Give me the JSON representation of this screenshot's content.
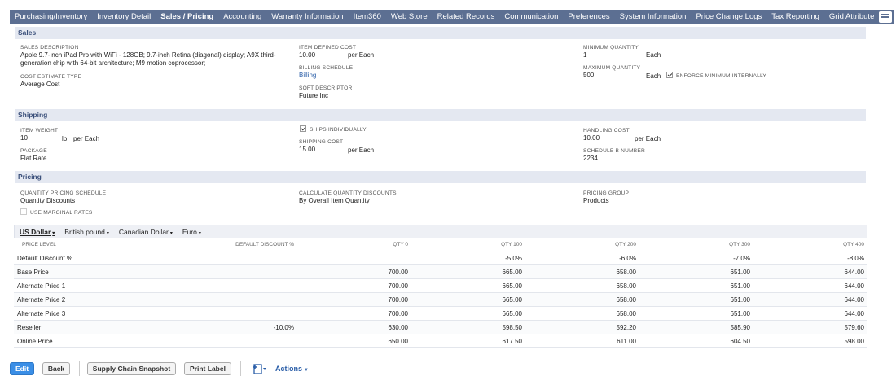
{
  "tabs": [
    "Purchasing/Inventory",
    "Inventory Detail",
    "Sales / Pricing",
    "Accounting",
    "Warranty Information",
    "Item360",
    "Web Store",
    "Related Records",
    "Communication",
    "Preferences",
    "System Information",
    "Price Change Logs",
    "Tax Reporting",
    "Grid Attribute"
  ],
  "active_tab": "Sales / Pricing",
  "sales": {
    "title": "Sales",
    "sales_description_label": "SALES DESCRIPTION",
    "sales_description_line1": "Apple 9.7-inch iPad Pro with WiFi - 128GB; 9.7-inch Retina (diagonal) display; A9X third-",
    "sales_description_line2": "generation chip with 64-bit architecture; M9 motion coprocessor;",
    "cost_estimate_type_label": "COST ESTIMATE TYPE",
    "cost_estimate_type": "Average Cost",
    "item_defined_cost_label": "ITEM DEFINED COST",
    "item_defined_cost": "10.00",
    "item_defined_cost_unit": "per Each",
    "billing_schedule_label": "BILLING SCHEDULE",
    "billing_schedule": "Billing",
    "soft_descriptor_label": "SOFT DESCRIPTOR",
    "soft_descriptor": "Future Inc",
    "minimum_quantity_label": "MINIMUM QUANTITY",
    "minimum_quantity": "1",
    "minimum_quantity_unit": "Each",
    "maximum_quantity_label": "MAXIMUM QUANTITY",
    "maximum_quantity": "500",
    "maximum_quantity_unit": "Each",
    "enforce_min_label": "ENFORCE MINIMUM INTERNALLY",
    "enforce_min_checked": true
  },
  "shipping": {
    "title": "Shipping",
    "item_weight_label": "ITEM WEIGHT",
    "item_weight": "10",
    "item_weight_unit1": "lb",
    "item_weight_unit2": "per Each",
    "package_label": "PACKAGE",
    "package": "Flat Rate",
    "ships_individually_label": "SHIPS INDIVIDUALLY",
    "ships_individually_checked": true,
    "shipping_cost_label": "SHIPPING COST",
    "shipping_cost": "15.00",
    "shipping_cost_unit": "per Each",
    "handling_cost_label": "HANDLING COST",
    "handling_cost": "10.00",
    "handling_cost_unit": "per Each",
    "schedule_b_label": "SCHEDULE B NUMBER",
    "schedule_b": "2234"
  },
  "pricing": {
    "title": "Pricing",
    "qty_schedule_label": "QUANTITY PRICING SCHEDULE",
    "qty_schedule": "Quantity Discounts",
    "use_marginal_label": "USE MARGINAL RATES",
    "calc_qty_label": "CALCULATE QUANTITY DISCOUNTS",
    "calc_qty": "By Overall Item Quantity",
    "pricing_group_label": "PRICING GROUP",
    "pricing_group": "Products",
    "currencies": [
      "US Dollar",
      "British pound",
      "Canadian Dollar",
      "Euro"
    ],
    "selected_currency": "US Dollar",
    "columns": [
      "PRICE LEVEL",
      "DEFAULT DISCOUNT %",
      "QTY 0",
      "QTY 100",
      "QTY 200",
      "QTY 300",
      "QTY 400"
    ],
    "rows": [
      [
        "Default Discount %",
        "",
        "",
        "-5.0%",
        "-6.0%",
        "-7.0%",
        "-8.0%"
      ],
      [
        "Base Price",
        "",
        "700.00",
        "665.00",
        "658.00",
        "651.00",
        "644.00"
      ],
      [
        "Alternate Price 1",
        "",
        "700.00",
        "665.00",
        "658.00",
        "651.00",
        "644.00"
      ],
      [
        "Alternate Price 2",
        "",
        "700.00",
        "665.00",
        "658.00",
        "651.00",
        "644.00"
      ],
      [
        "Alternate Price 3",
        "",
        "700.00",
        "665.00",
        "658.00",
        "651.00",
        "644.00"
      ],
      [
        "Reseller",
        "-10.0%",
        "630.00",
        "598.50",
        "592.20",
        "585.90",
        "579.60"
      ],
      [
        "Online Price",
        "",
        "650.00",
        "617.50",
        "611.00",
        "604.50",
        "598.00"
      ]
    ]
  },
  "buttons": {
    "edit": "Edit",
    "back": "Back",
    "supply_chain": "Supply Chain Snapshot",
    "print_label": "Print Label",
    "actions": "Actions"
  }
}
